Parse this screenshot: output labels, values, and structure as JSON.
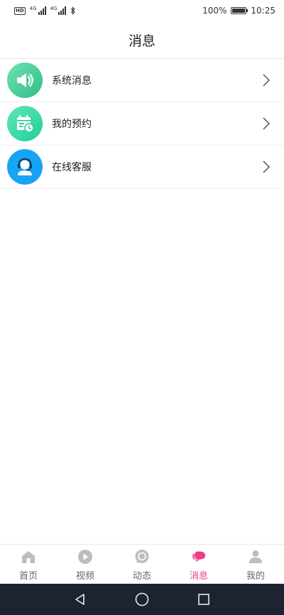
{
  "status_bar": {
    "left_badges": [
      "HD",
      "4G",
      "4G"
    ],
    "battery": "100%",
    "time": "10:25"
  },
  "header": {
    "title": "消息"
  },
  "list": [
    {
      "label": "系统消息",
      "icon": "speaker-icon",
      "color": "#34c98f"
    },
    {
      "label": "我的预约",
      "icon": "calendar-clock-icon",
      "color": "#2fd6a4"
    },
    {
      "label": "在线客服",
      "icon": "customer-service-icon",
      "color": "#18a4f5"
    }
  ],
  "tabbar": {
    "tabs": [
      {
        "label": "首页",
        "icon": "home-icon"
      },
      {
        "label": "视频",
        "icon": "play-icon"
      },
      {
        "label": "动态",
        "icon": "chat-bubble-icon"
      },
      {
        "label": "消息",
        "icon": "messages-icon",
        "active": true
      },
      {
        "label": "我的",
        "icon": "user-icon"
      }
    ],
    "active_color": "#e83e8c",
    "inactive_color": "#bdbdbd"
  },
  "nav": {
    "buttons": [
      "back-icon",
      "home-circle-icon",
      "recents-icon"
    ]
  }
}
